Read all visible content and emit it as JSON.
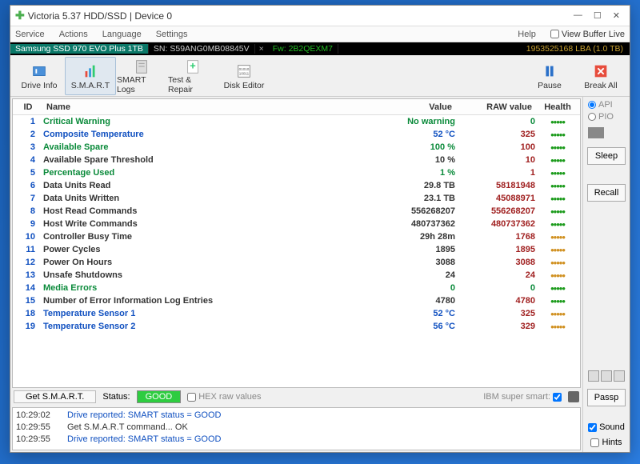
{
  "title": "Victoria 5.37 HDD/SSD | Device 0",
  "menu": {
    "m1": "Service",
    "m2": "Actions",
    "m3": "Language",
    "m4": "Settings",
    "m5": "Help",
    "vbl": "View Buffer Live"
  },
  "dev": {
    "name": "Samsung SSD 970 EVO Plus 1TB",
    "sn_label": "SN:",
    "sn": "S59ANG0MB08845V",
    "fw_label": "Fw:",
    "fw": "2B2QEXM7",
    "size": "1953525168 LBA (1.0 TB)"
  },
  "toolbar": {
    "driveinfo": "Drive Info",
    "smart": "S.M.A.R.T",
    "smartlogs": "SMART Logs",
    "test": "Test & Repair",
    "diskedit": "Disk Editor",
    "pause": "Pause",
    "breakall": "Break All"
  },
  "head": {
    "id": "ID",
    "name": "Name",
    "val": "Value",
    "raw": "RAW value",
    "health": "Health"
  },
  "rows": [
    {
      "id": "1",
      "name": "Critical Warning",
      "nc": "green",
      "val": "No warning",
      "vc": "green",
      "raw": "0",
      "rc": "green",
      "h": "g"
    },
    {
      "id": "2",
      "name": "Composite Temperature",
      "nc": "blue",
      "val": "52 °C",
      "vc": "blue",
      "raw": "325",
      "rc": "",
      "h": "g"
    },
    {
      "id": "3",
      "name": "Available Spare",
      "nc": "green",
      "val": "100 %",
      "vc": "green",
      "raw": "100",
      "rc": "",
      "h": "g"
    },
    {
      "id": "4",
      "name": "Available Spare Threshold",
      "nc": "",
      "val": "10 %",
      "vc": "",
      "raw": "10",
      "rc": "",
      "h": "g"
    },
    {
      "id": "5",
      "name": "Percentage Used",
      "nc": "green",
      "val": "1 %",
      "vc": "green",
      "raw": "1",
      "rc": "",
      "h": "g"
    },
    {
      "id": "6",
      "name": "Data Units Read",
      "nc": "",
      "val": "29.8 TB",
      "vc": "",
      "raw": "58181948",
      "rc": "",
      "h": "g"
    },
    {
      "id": "7",
      "name": "Data Units Written",
      "nc": "",
      "val": "23.1 TB",
      "vc": "",
      "raw": "45088971",
      "rc": "",
      "h": "g"
    },
    {
      "id": "8",
      "name": "Host Read Commands",
      "nc": "",
      "val": "556268207",
      "vc": "",
      "raw": "556268207",
      "rc": "",
      "h": "g"
    },
    {
      "id": "9",
      "name": "Host Write Commands",
      "nc": "",
      "val": "480737362",
      "vc": "",
      "raw": "480737362",
      "rc": "",
      "h": "g"
    },
    {
      "id": "10",
      "name": "Controller Busy Time",
      "nc": "",
      "val": "29h 28m",
      "vc": "",
      "raw": "1768",
      "rc": "",
      "h": "o"
    },
    {
      "id": "11",
      "name": "Power Cycles",
      "nc": "",
      "val": "1895",
      "vc": "",
      "raw": "1895",
      "rc": "",
      "h": "o"
    },
    {
      "id": "12",
      "name": "Power On Hours",
      "nc": "",
      "val": "3088",
      "vc": "",
      "raw": "3088",
      "rc": "",
      "h": "o"
    },
    {
      "id": "13",
      "name": "Unsafe Shutdowns",
      "nc": "",
      "val": "24",
      "vc": "",
      "raw": "24",
      "rc": "",
      "h": "o"
    },
    {
      "id": "14",
      "name": "Media Errors",
      "nc": "green",
      "val": "0",
      "vc": "green",
      "raw": "0",
      "rc": "green",
      "h": "g"
    },
    {
      "id": "15",
      "name": "Number of Error Information Log Entries",
      "nc": "",
      "val": "4780",
      "vc": "",
      "raw": "4780",
      "rc": "",
      "h": "g"
    },
    {
      "id": "18",
      "name": "Temperature Sensor 1",
      "nc": "blue",
      "val": "52 °C",
      "vc": "blue",
      "raw": "325",
      "rc": "",
      "h": "o"
    },
    {
      "id": "19",
      "name": "Temperature Sensor 2",
      "nc": "blue",
      "val": "56 °C",
      "vc": "blue",
      "raw": "329",
      "rc": "",
      "h": "o"
    }
  ],
  "status": {
    "get": "Get S.M.A.R.T.",
    "label": "Status:",
    "good": "GOOD",
    "hex": "HEX raw values",
    "ibm": "IBM super smart:"
  },
  "log": [
    {
      "t": "10:29:02",
      "m": "Drive reported: SMART status = GOOD",
      "c": "blue"
    },
    {
      "t": "10:29:55",
      "m": "Get S.M.A.R.T command... OK",
      "c": ""
    },
    {
      "t": "10:29:55",
      "m": "Drive reported: SMART status = GOOD",
      "c": "blue"
    }
  ],
  "side": {
    "api": "API",
    "pio": "PIO",
    "sleep": "Sleep",
    "recall": "Recall",
    "passp": "Passp",
    "sound": "Sound",
    "hints": "Hints"
  }
}
